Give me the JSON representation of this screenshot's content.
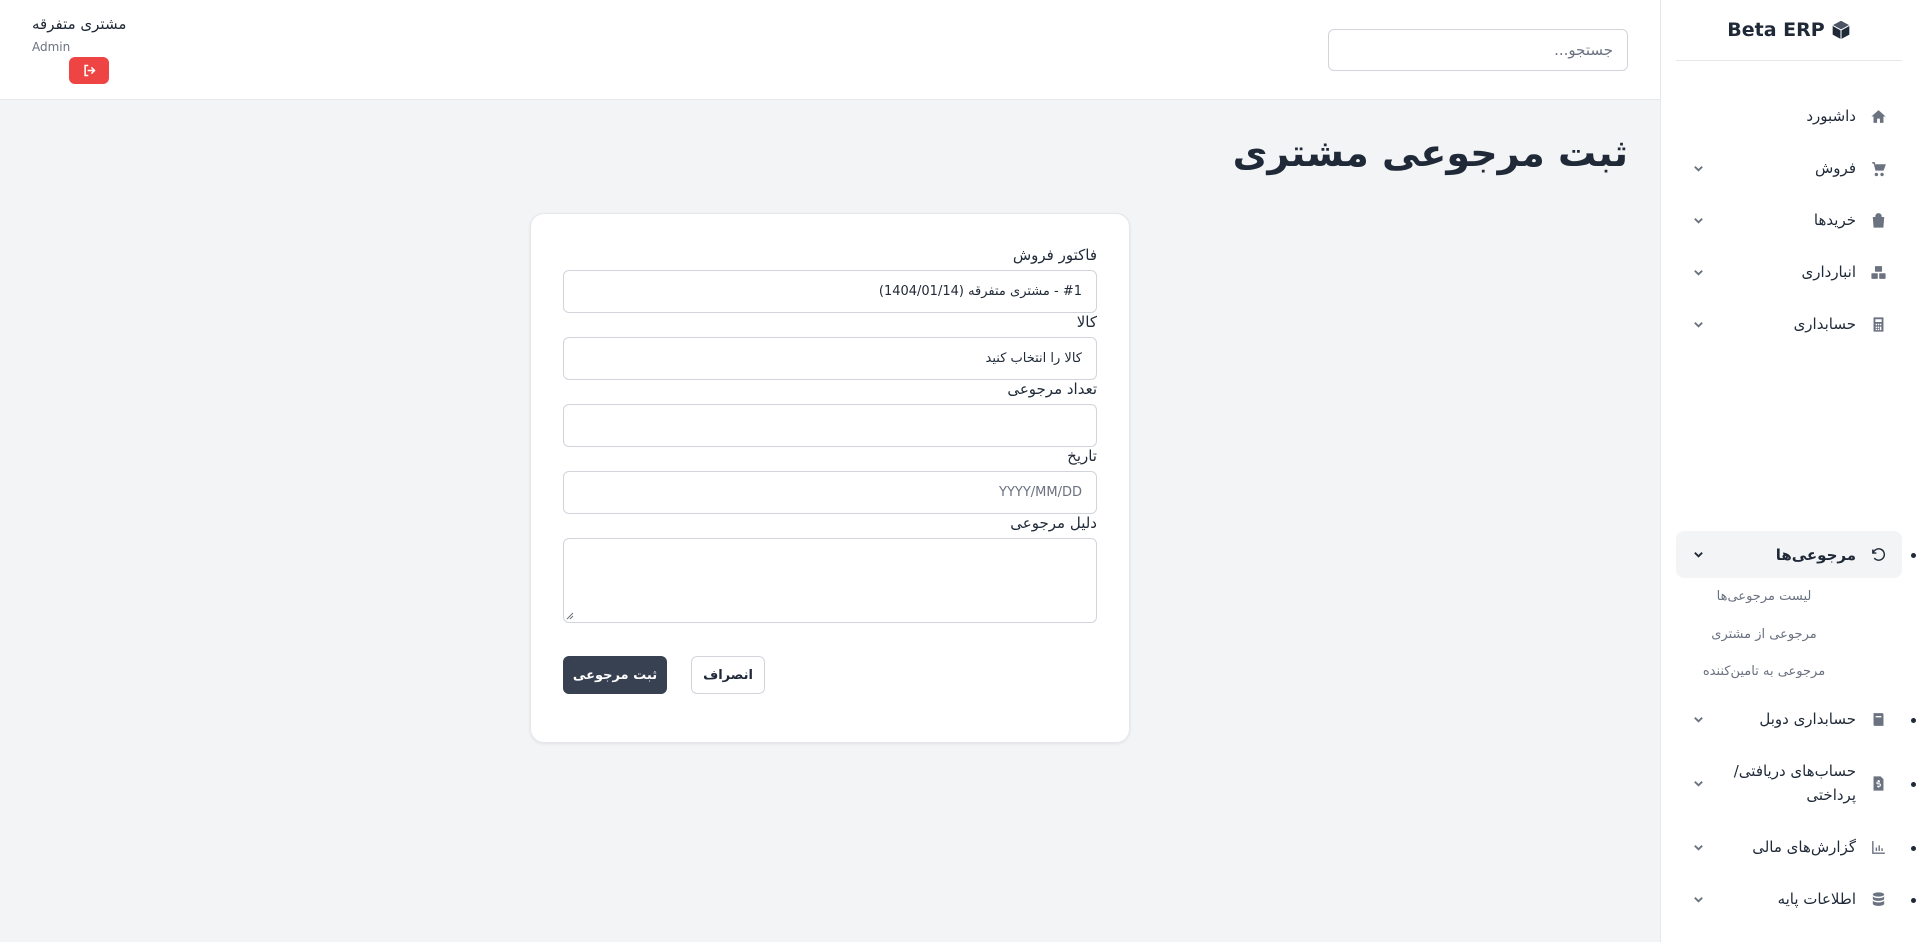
{
  "brand": {
    "name": "Beta ERP",
    "icon": "cube-icon"
  },
  "sidebar": {
    "items": [
      {
        "label": "داشبورد",
        "icon": "home-icon",
        "has_chevron": false
      },
      {
        "label": "فروش",
        "icon": "cart-icon",
        "has_chevron": true
      },
      {
        "label": "خریدها",
        "icon": "bag-icon",
        "has_chevron": true
      },
      {
        "label": "انبارداری",
        "icon": "boxes-icon",
        "has_chevron": true
      },
      {
        "label": "حسابداری",
        "icon": "calculator-icon",
        "has_chevron": true
      },
      {
        "label": "مرجوعی‌ها",
        "icon": "undo-icon",
        "has_chevron": true,
        "active": true,
        "children": [
          "لیست مرجوعی‌ها",
          "مرجوعی از مشتری",
          "مرجوعی به تامین‌کننده"
        ]
      },
      {
        "label": "حسابداری دوبل",
        "icon": "book-icon",
        "has_chevron": true
      },
      {
        "label_line1": "حساب‌های دریافتی/",
        "label_line2": "پرداختی",
        "icon": "invoice-icon",
        "has_chevron": true
      },
      {
        "label": "گزارش‌های مالی",
        "icon": "chart-icon",
        "has_chevron": true
      },
      {
        "label": "اطلاعات پایه",
        "icon": "database-icon",
        "has_chevron": true
      }
    ]
  },
  "header": {
    "search_placeholder": "جستجو...",
    "user_name": "مشتری متفرقه",
    "user_role": "Admin",
    "logout_icon": "logout-icon"
  },
  "page": {
    "title": "ثبت مرجوعی مشتری"
  },
  "form": {
    "invoice_label": "فاکتور فروش",
    "invoice_value": "#1 - مشتری متفرقه (1404/01/14)",
    "product_label": "کالا",
    "product_value": "کالا را انتخاب کنید",
    "quantity_label": "تعداد مرجوعی",
    "quantity_value": "",
    "date_label": "تاریخ",
    "date_placeholder": "YYYY/MM/DD",
    "reason_label": "دلیل مرجوعی",
    "reason_value": "",
    "submit_label": "ثبت مرجوعی",
    "cancel_label": "انصراف"
  },
  "colors": {
    "primary_button": "#374151",
    "logout_button": "#ef4444",
    "page_background": "#f3f4f6"
  }
}
